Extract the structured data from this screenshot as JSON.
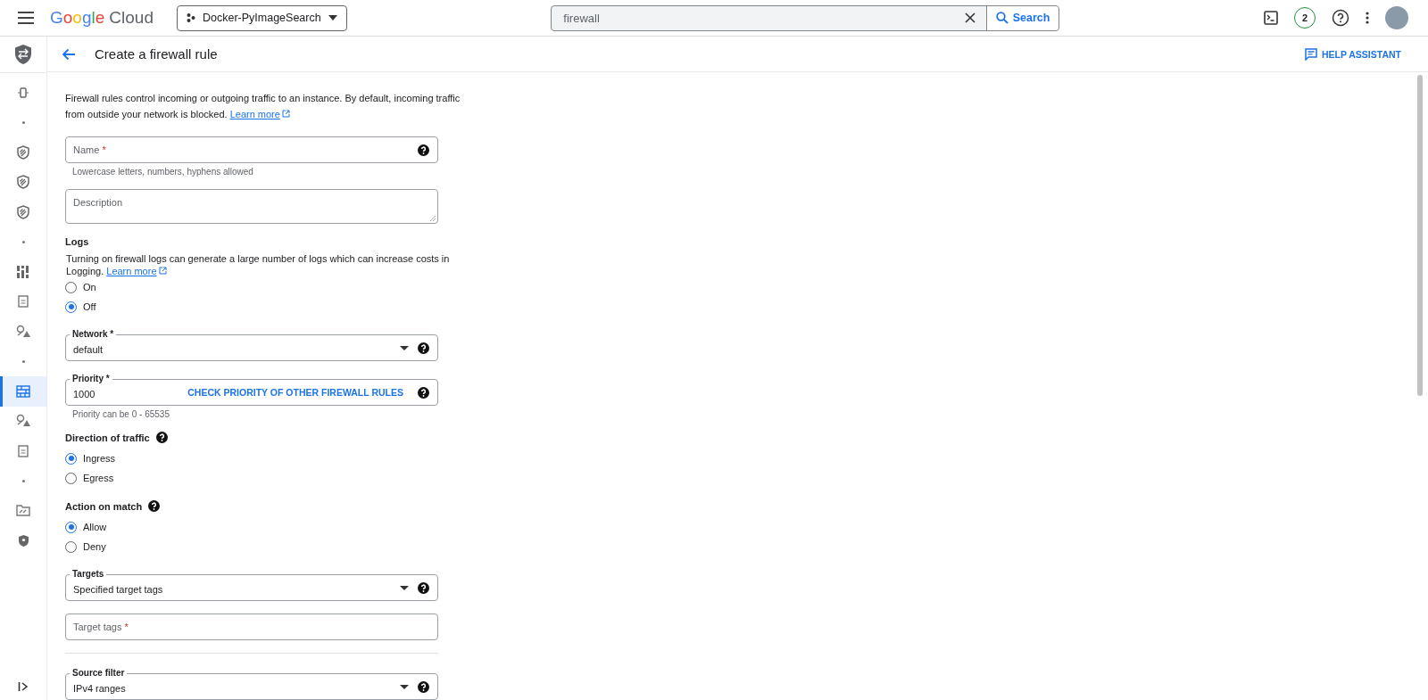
{
  "topbar": {
    "brand": "Google",
    "product": "Cloud",
    "project": "Docker-PyImageSearch",
    "search": {
      "value": "firewall",
      "button": "Search"
    },
    "notifications": "2"
  },
  "sidebar": {
    "items": [
      {
        "kind": "connect",
        "selected": false
      },
      {
        "kind": "dot",
        "selected": false
      },
      {
        "kind": "shield",
        "selected": false
      },
      {
        "kind": "shield",
        "selected": false
      },
      {
        "kind": "shield",
        "selected": false
      },
      {
        "kind": "dot",
        "selected": false
      },
      {
        "kind": "grid",
        "selected": false
      },
      {
        "kind": "doc",
        "selected": false
      },
      {
        "kind": "routes",
        "selected": false
      },
      {
        "kind": "dot",
        "selected": false
      },
      {
        "kind": "firewall",
        "selected": true
      },
      {
        "kind": "routes",
        "selected": false
      },
      {
        "kind": "doc",
        "selected": false
      },
      {
        "kind": "dot",
        "selected": false
      },
      {
        "kind": "folder",
        "selected": false
      },
      {
        "kind": "security",
        "selected": false
      }
    ]
  },
  "page": {
    "title": "Create a firewall rule",
    "help_assistant": "HELP ASSISTANT"
  },
  "intro": {
    "text": "Firewall rules control incoming or outgoing traffic to an instance. By default, incoming traffic from outside your network is blocked.",
    "link": "Learn more"
  },
  "form": [
    {
      "kind": "input",
      "label": "Name",
      "required_mark": "*",
      "help": true,
      "hint": "Lowercase letters, numbers, hyphens allowed"
    },
    {
      "kind": "textarea",
      "label": "Description"
    },
    {
      "kind": "radio",
      "title": "Logs",
      "help": false,
      "note": "Turning on firewall logs can generate a large number of logs which can increase costs in Logging.",
      "note_link": "Learn more",
      "options": [
        {
          "label": "On",
          "selected": false
        },
        {
          "label": "Off",
          "selected": true
        }
      ]
    },
    {
      "kind": "select",
      "label": "Network *",
      "value": "default"
    },
    {
      "kind": "outlined",
      "label": "Priority *",
      "value": "1000",
      "action": "CHECK PRIORITY OF OTHER FIREWALL RULES",
      "hint": "Priority can be 0 - 65535"
    },
    {
      "kind": "radio",
      "title": "Direction of traffic",
      "help": true,
      "options": [
        {
          "label": "Ingress",
          "selected": true
        },
        {
          "label": "Egress",
          "selected": false
        }
      ]
    },
    {
      "kind": "radio",
      "title": "Action on match",
      "help": true,
      "options": [
        {
          "label": "Allow",
          "selected": true
        },
        {
          "label": "Deny",
          "selected": false
        }
      ]
    },
    {
      "kind": "select",
      "label": "Targets",
      "value": "Specified target tags"
    },
    {
      "kind": "input",
      "label": "Target tags",
      "required_mark": "*",
      "help": false
    },
    {
      "kind": "divider"
    },
    {
      "kind": "select",
      "label": "Source filter",
      "value": "IPv4 ranges"
    }
  ]
}
